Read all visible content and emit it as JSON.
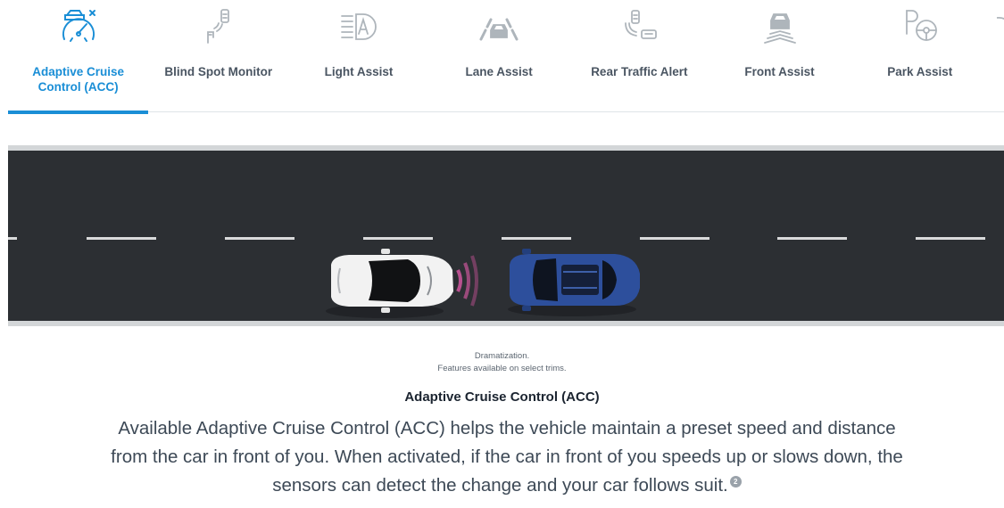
{
  "tabs": [
    {
      "label": "Adaptive Cruise Control (ACC)",
      "icon": "speedometer-car-icon",
      "active": true
    },
    {
      "label": "Blind Spot Monitor",
      "icon": "blind-spot-mirror-icon",
      "active": false
    },
    {
      "label": "Light Assist",
      "icon": "headlight-assist-icon",
      "active": false
    },
    {
      "label": "Lane Assist",
      "icon": "lane-car-icon",
      "active": false
    },
    {
      "label": "Rear Traffic Alert",
      "icon": "rear-traffic-icon",
      "active": false
    },
    {
      "label": "Front Assist",
      "icon": "front-assist-car-icon",
      "active": false
    },
    {
      "label": "Park Assist",
      "icon": "park-steering-icon",
      "active": false
    }
  ],
  "caption": {
    "line1": "Dramatization.",
    "line2": "Features available on select trims."
  },
  "feature": {
    "title": "Adaptive Cruise Control (ACC)",
    "description": "Available Adaptive Cruise Control (ACC) helps the vehicle maintain a preset speed and distance from the car in front of you. When activated, if the car in front of you speeds up or slows down, the sensors can detect the change and your car follows suit.",
    "footnote": "2"
  },
  "colors": {
    "accent": "#1a8ed6",
    "road": "#2c2f33",
    "sensor": "#c9559a",
    "lead_car": "#2d4f9c",
    "own_car": "#f2f2f2"
  }
}
